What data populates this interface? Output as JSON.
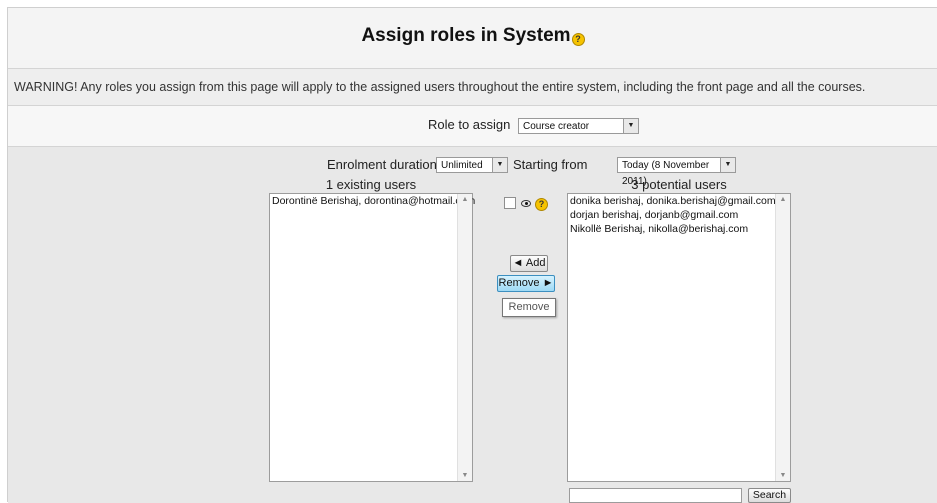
{
  "page": {
    "title": "Assign roles in System",
    "help_glyph": "?",
    "warning": "WARNING! Any roles you assign from this page will apply to the assigned users throughout the entire system, including the front page and all the courses."
  },
  "role": {
    "label": "Role to assign",
    "selected": "Course creator"
  },
  "enrolment": {
    "duration_label": "Enrolment duration",
    "duration_value": "Unlimited",
    "start_label": "Starting from",
    "start_value": "Today (8 November 2011)"
  },
  "existing": {
    "heading": "1 existing users",
    "items": [
      "Dorontinë Berishaj, dorontina@hotmail.com"
    ]
  },
  "potential": {
    "heading": "3 potential users",
    "items": [
      "donika berishaj, donika.berishaj@gmail.com",
      "dorjan berishaj, dorjanb@gmail.com",
      "Nikollë Berishaj, nikolla@berishaj.com"
    ]
  },
  "buttons": {
    "add": "◄ Add",
    "remove": "Remove ►",
    "remove_tooltip": "Remove",
    "search": "Search"
  },
  "search": {
    "value": ""
  },
  "icons": {
    "help": "help-icon",
    "eye": "eye-icon",
    "dropdown": "chevron-down-icon",
    "scroll_up": "scroll-up-arrow",
    "scroll_down": "scroll-down-arrow"
  },
  "colors": {
    "help_icon": "#f6c300",
    "remove_button_active": "#9ed9f5"
  }
}
